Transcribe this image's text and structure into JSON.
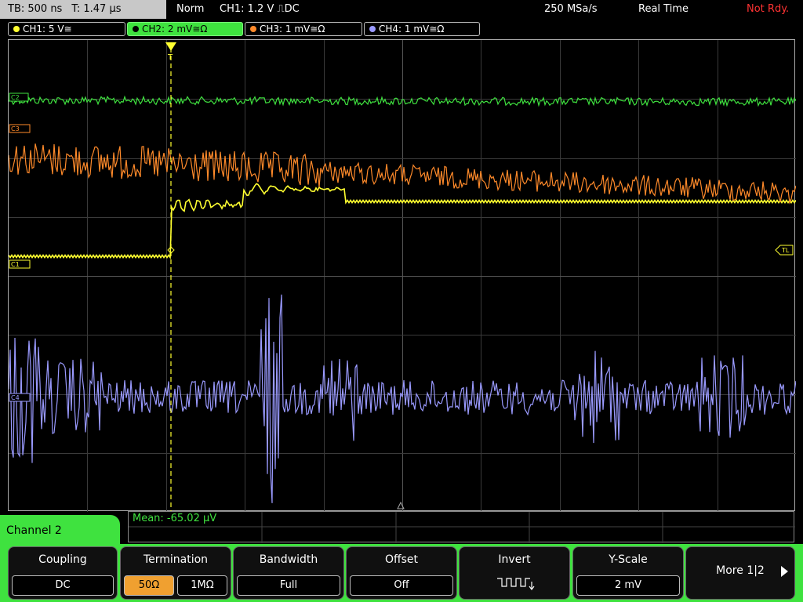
{
  "top": {
    "timebase": "TB: 500 ns",
    "trigger_time": "T: 1.47 µs",
    "trigger_mode": "Norm",
    "trigger_source": "CH1: 1.2 V ⎍DC",
    "sample_rate": "250 MSa/s",
    "acq_mode": "Real Time",
    "status": "Not Rdy."
  },
  "channels": [
    {
      "label": "CH1: 5 V≅",
      "color": "#ffff30"
    },
    {
      "label": "CH2: 2 mV≅Ω",
      "color": "#3fe23f"
    },
    {
      "label": "CH3: 1 mV≅Ω",
      "color": "#ff8a2a"
    },
    {
      "label": "CH4: 1 mV≅Ω",
      "color": "#9a9aff"
    }
  ],
  "markers": {
    "c2": "C2",
    "c3": "C3",
    "c1": "C1",
    "c4": "C4",
    "trigger_level": "TL",
    "trigger_pos": "T"
  },
  "measurement": {
    "label": "Mean: -65.02 µV"
  },
  "menu_title": "Channel 2",
  "softkeys": {
    "coupling": {
      "label": "Coupling",
      "value": "DC"
    },
    "termination": {
      "label": "Termination",
      "value_a": "50Ω",
      "value_b": "1MΩ"
    },
    "bandwidth": {
      "label": "Bandwidth",
      "value": "Full"
    },
    "offset": {
      "label": "Offset",
      "value": "Off"
    },
    "invert": {
      "label": "Invert"
    },
    "yscale": {
      "label": "Y-Scale",
      "value": "2 mV"
    },
    "more": {
      "label": "More 1|2"
    }
  }
}
